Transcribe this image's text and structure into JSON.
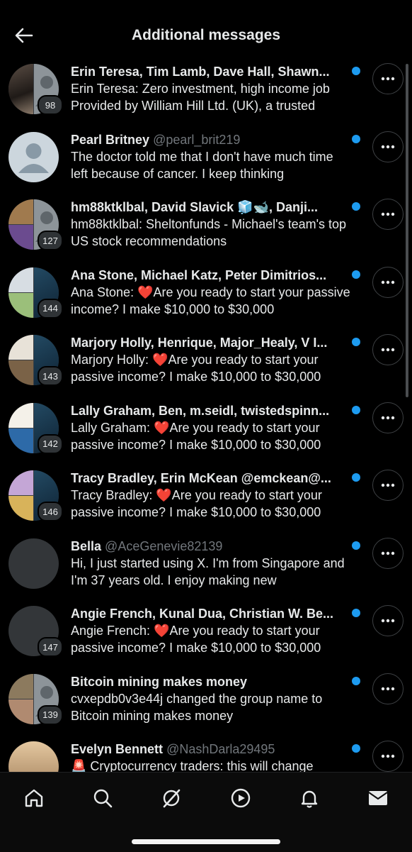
{
  "header": {
    "title": "Additional messages"
  },
  "colors": {
    "unread": "#1d9bf0",
    "background": "#000000",
    "muted": "#71767b"
  },
  "conversations": [
    {
      "name": "Erin Teresa, Tim Lamb, Dave Hall, Shawn...",
      "handle": "",
      "preview": "Erin Teresa: Zero investment, high income job Provided by William Hill Ltd. (UK), a trusted",
      "count": "98"
    },
    {
      "name": "Pearl Britney",
      "handle": "@pearl_brit219",
      "preview": "The doctor told me that I don't have much time left because of cancer. I keep thinking",
      "count": ""
    },
    {
      "name": "hm88ktklbal, David Slavick 🧊🐋, Danji...",
      "handle": "",
      "preview": "hm88ktklbal: Sheltonfunds - Michael's team's top US stock recommendations",
      "count": "127"
    },
    {
      "name": "Ana Stone, Michael Katz, Peter Dimitrios...",
      "handle": "",
      "preview_prefix": "Ana Stone: ",
      "preview": "Are you ready to start your passive income? I make $10,000 to $30,000",
      "count": "144"
    },
    {
      "name": "Marjory Holly, Henrique, Major_Healy, V I...",
      "handle": "",
      "preview_prefix": "Marjory Holly: ",
      "preview": "Are you ready to start your passive income? I make $10,000 to $30,000",
      "count": "143"
    },
    {
      "name": "Lally Graham, Ben, m.seidl, twistedspinn...",
      "handle": "",
      "preview_prefix": "Lally Graham: ",
      "preview": "Are you ready to start your passive income? I make $10,000 to $30,000",
      "count": "142"
    },
    {
      "name": "Tracy Bradley, Erin McKean @emckean@...",
      "handle": "",
      "preview_prefix": "Tracy Bradley: ",
      "preview": "Are you ready to start your passive income? I make $10,000 to $30,000",
      "count": "146"
    },
    {
      "name": "Bella",
      "handle": "@AceGenevie82139",
      "preview": "Hi, I just started using X. I'm from Singapore and I'm 37 years old. I enjoy making new",
      "count": ""
    },
    {
      "name": "Angie French, Kunal Dua, Christian W. Be...",
      "handle": "",
      "preview_prefix": "Angie French: ",
      "preview": "Are you ready to start your passive income? I make $10,000 to $30,000",
      "count": "147"
    },
    {
      "name": "Bitcoin mining makes money",
      "handle": "",
      "preview": "cvxepdb0v3e44j changed the group name to Bitcoin mining makes money",
      "count": "139"
    },
    {
      "name": "Evelyn Bennett",
      "handle": "@NashDarla29495",
      "preview": "🚨 Cryptocurrency traders: this will change",
      "count": ""
    }
  ],
  "tabbar": [
    "home-icon",
    "search-icon",
    "grok-icon",
    "video-icon",
    "notifications-icon",
    "messages-icon"
  ]
}
